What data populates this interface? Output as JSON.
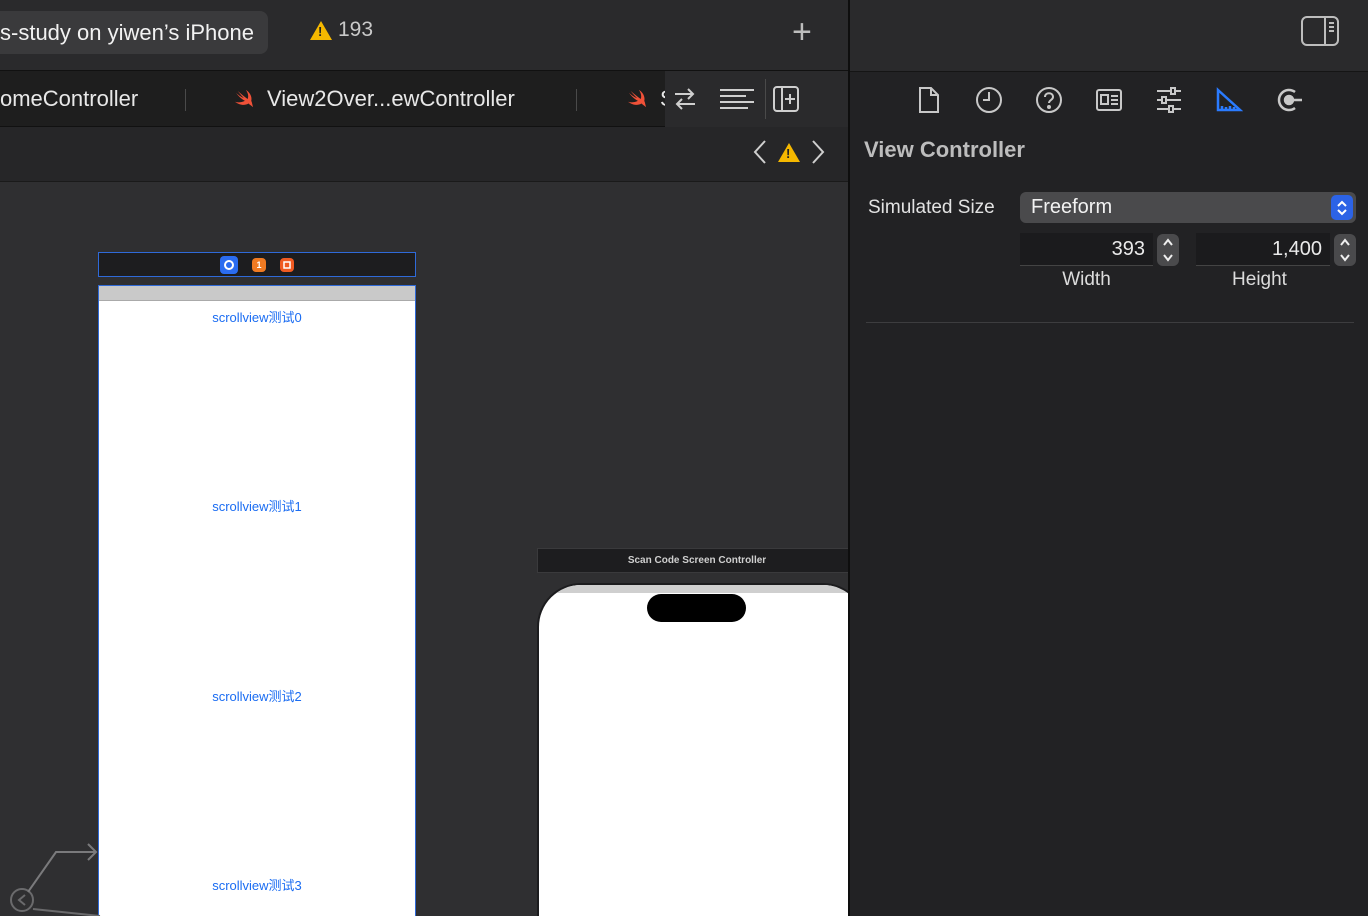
{
  "toolbar": {
    "scheme_label": "s-study on yiwen’s iPhone",
    "warning_count": "193",
    "add_label": "+"
  },
  "tabs": [
    {
      "label": "omeController"
    },
    {
      "label": "View2Over...ewController"
    },
    {
      "label": "S"
    }
  ],
  "canvas": {
    "scene1": {
      "labels": [
        "scrollview测试0",
        "scrollview测试1",
        "scrollview测试2",
        "scrollview测试3"
      ],
      "header_icons": [
        "view-controller-icon",
        "first-responder-icon",
        "exit-icon"
      ],
      "header_icon_glyphs": [
        "",
        "1",
        ""
      ]
    },
    "scene2": {
      "title": "Scan Code Screen Controller"
    }
  },
  "inspector": {
    "title": "View Controller",
    "simulated_size_label": "Simulated Size",
    "simulated_size_value": "Freeform",
    "width_value": "393",
    "width_label": "Width",
    "height_value": "1,400",
    "height_label": "Height",
    "tabs": [
      "file-icon",
      "history-icon",
      "help-icon",
      "identity-icon",
      "attributes-icon",
      "size-icon",
      "connections-icon"
    ],
    "active_tab": "size-icon"
  },
  "colors": {
    "accent": "#2a7bff",
    "warning": "#f5b800",
    "swift": "#f05138",
    "link_blue": "#1a6cf2"
  }
}
